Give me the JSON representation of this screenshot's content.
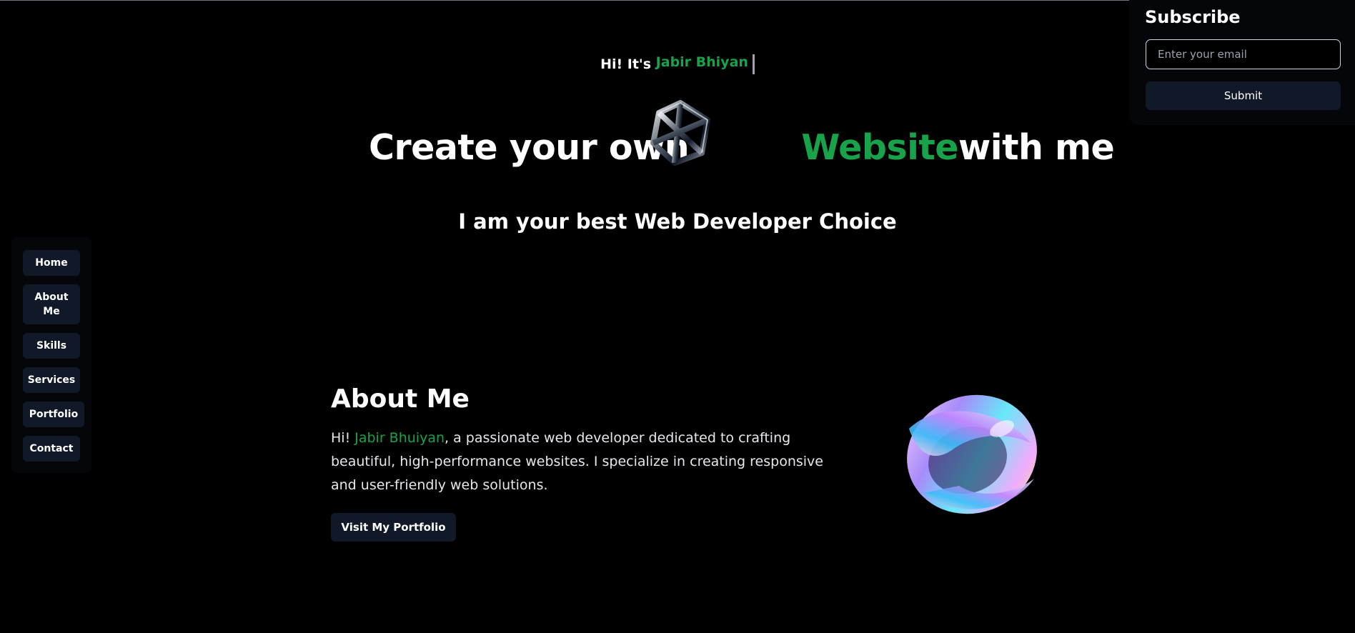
{
  "hero": {
    "greeting_prefix": "Hi! It's",
    "greeting_name": "Jabir Bhiyan",
    "headline_before": "Create your own",
    "headline_highlight": "Website",
    "headline_after": "with me",
    "subheadline": "I am your best Web Developer Choice"
  },
  "subscribe": {
    "title": "Subscribe",
    "email_placeholder": "Enter your email",
    "submit_label": "Submit"
  },
  "sidebar": {
    "items": [
      {
        "label": "Home"
      },
      {
        "label": "About Me"
      },
      {
        "label": "Skills"
      },
      {
        "label": "Services"
      },
      {
        "label": "Portfolio"
      },
      {
        "label": "Contact"
      }
    ]
  },
  "about": {
    "title": "About Me",
    "text_prefix": "Hi! ",
    "name": "Jabir Bhuiyan",
    "text_rest": ", a passionate web developer dedicated to crafting beautiful, high-performance websites. I specialize in creating responsive and user-friendly web solutions.",
    "button_label": "Visit My Portfolio"
  },
  "colors": {
    "background": "#000000",
    "accent_green": "#16a34a",
    "button_bg": "#111827",
    "panel_bg": "#05060a"
  },
  "icons": {
    "hero_graphic": "chrome-knot-3d-icon",
    "about_graphic": "iridescent-torus-3d-image"
  }
}
